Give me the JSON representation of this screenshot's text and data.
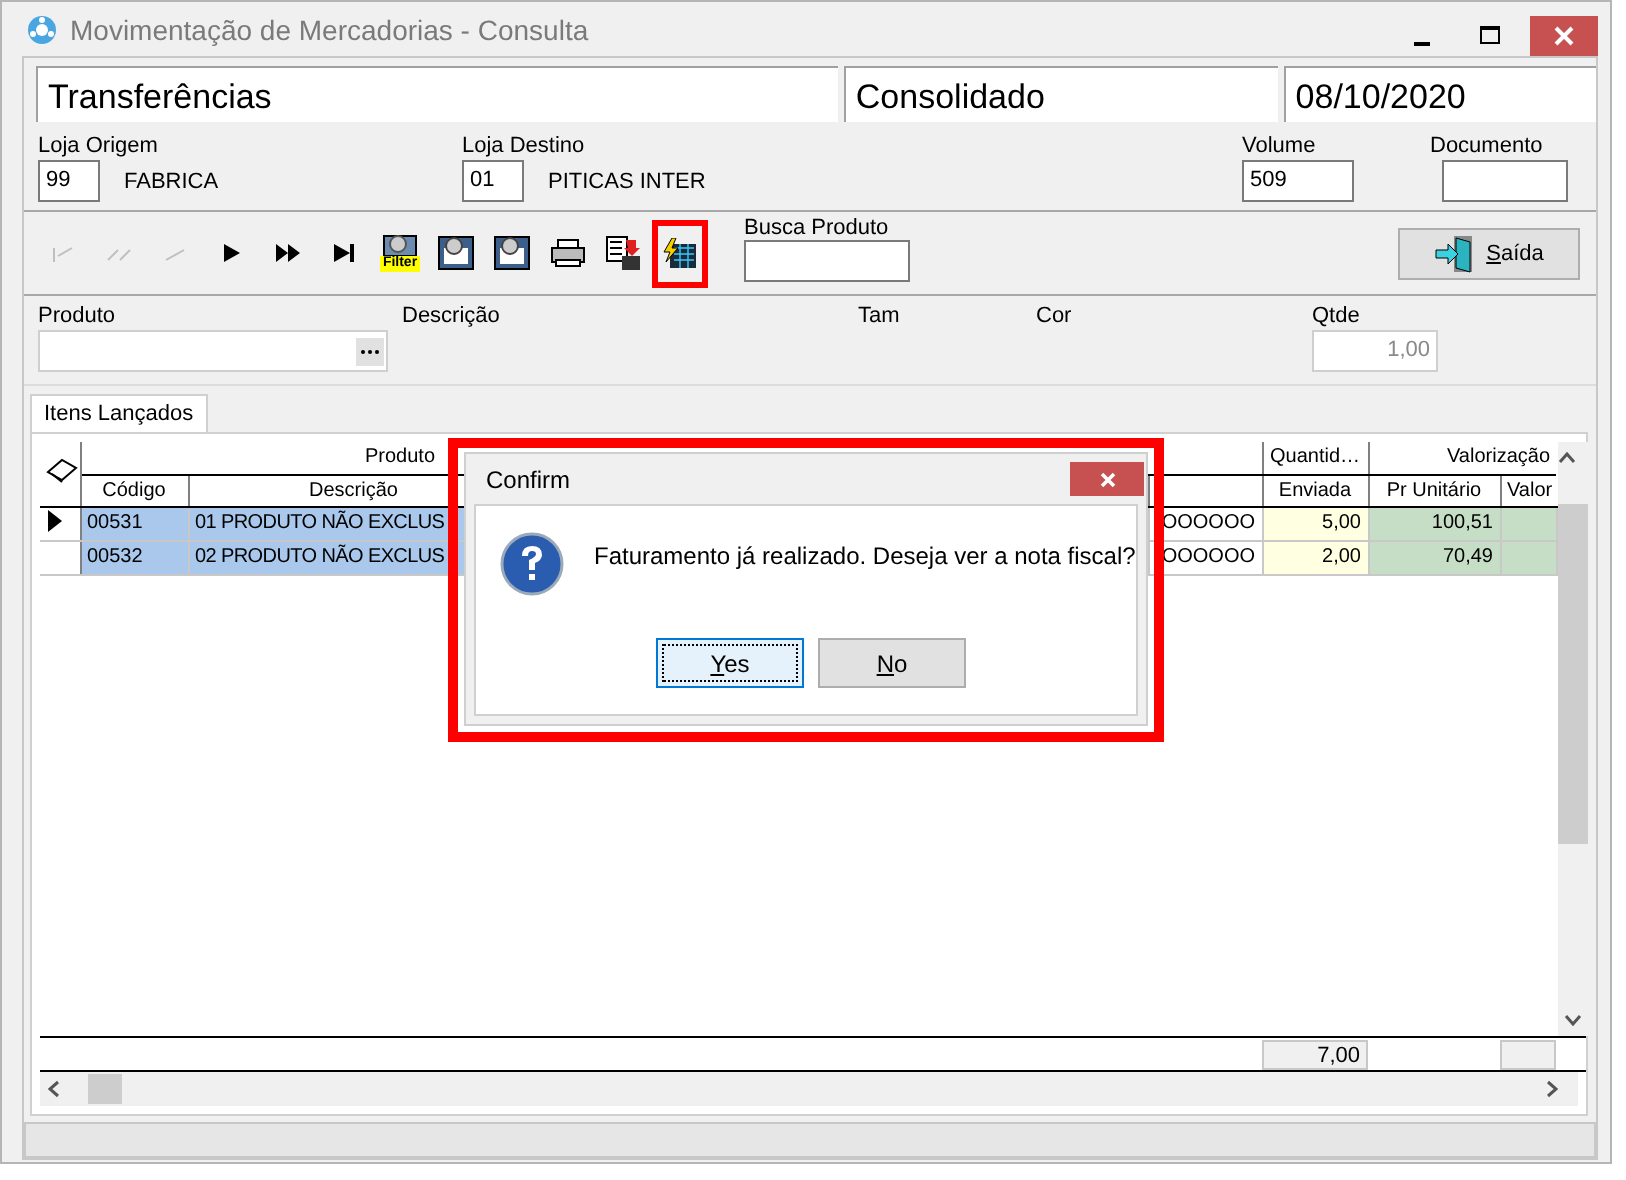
{
  "window": {
    "title": "Movimentação de Mercadorias - Consulta"
  },
  "header": {
    "operation": "Transferências",
    "status": "Consolidado",
    "date": "08/10/2020"
  },
  "fields": {
    "origin_label": "Loja Origem",
    "origin_code": "99",
    "origin_name": "FABRICA",
    "destination_label": "Loja Destino",
    "destination_code": "01",
    "destination_name": "PITICAS INTER",
    "volume_label": "Volume",
    "volume": "509",
    "document_label": "Documento"
  },
  "toolbar": {
    "buttons": [
      {
        "kind": "first",
        "disabled": true,
        "highlighted": false
      },
      {
        "kind": "prior-page",
        "disabled": true,
        "highlighted": false
      },
      {
        "kind": "prior",
        "disabled": true,
        "highlighted": false
      },
      {
        "kind": "next",
        "disabled": false,
        "highlighted": false
      },
      {
        "kind": "next-page",
        "disabled": false,
        "highlighted": false
      },
      {
        "kind": "last",
        "disabled": false,
        "highlighted": false
      },
      {
        "kind": "filter",
        "label": "Filter",
        "disabled": false,
        "highlighted": false
      },
      {
        "kind": "grid-search",
        "disabled": false,
        "highlighted": false
      },
      {
        "kind": "grid-edit",
        "disabled": false,
        "highlighted": false
      },
      {
        "kind": "print",
        "disabled": false,
        "highlighted": false
      },
      {
        "kind": "export",
        "disabled": false,
        "highlighted": false
      },
      {
        "kind": "invoice",
        "disabled": false,
        "highlighted": true
      }
    ],
    "search_label": "Busca Produto",
    "exit_button": "Saída"
  },
  "product_row": {
    "product_label": "Produto",
    "description_label": "Descrição",
    "size_label": "Tam",
    "color_label": "Cor",
    "qty_label": "Qtde",
    "qty": "1,00"
  },
  "tabs": [
    {
      "label": "Itens Lançados",
      "selected": true
    }
  ],
  "grid": {
    "group_headers": [
      "Produto",
      "Quantid…",
      "Valorização"
    ],
    "columns": [
      "Código",
      "Descrição",
      "Enviada",
      "Pr Unitário",
      "Valor"
    ],
    "rows": [
      {
        "current": true,
        "code": "00531",
        "description": "01 PRODUTO NÃO EXCLUS",
        "column_3": "OOOOOO",
        "sent": "5,00",
        "unit_price": "100,51"
      },
      {
        "current": false,
        "code": "00532",
        "description": "02 PRODUTO NÃO EXCLUS",
        "column_3": "OOOOOO",
        "sent": "2,00",
        "unit_price": "70,49"
      }
    ],
    "total_sent": "7,00"
  },
  "dialog": {
    "title": "Confirm",
    "message": "Faturamento já realizado. Deseja ver a nota fiscal?",
    "buttons": [
      {
        "label": "Yes",
        "selected": true
      },
      {
        "label": "No",
        "selected": false
      }
    ],
    "highlighted": true
  }
}
